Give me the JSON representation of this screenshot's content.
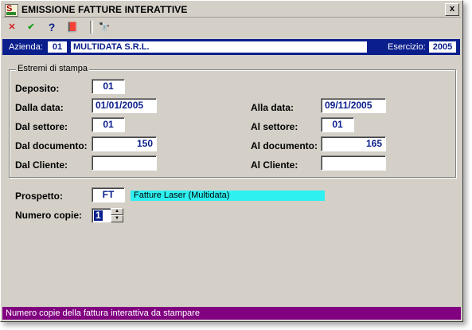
{
  "window": {
    "title": "EMISSIONE FATTURE INTERATTIVE",
    "close_label": "x"
  },
  "toolbar": {
    "cancel": "✕",
    "confirm": "✔",
    "help": "?",
    "book": "📕",
    "find": "🔭"
  },
  "company_bar": {
    "azienda_label": "Azienda:",
    "azienda_code": "01",
    "azienda_name": "MULTIDATA S.R.L.",
    "esercizio_label": "Esercizio:",
    "esercizio_value": "2005"
  },
  "group": {
    "title": "Estremi di stampa"
  },
  "fields": {
    "deposito_label": "Deposito:",
    "deposito_value": "01",
    "dalla_data_label": "Dalla data:",
    "dalla_data_value": "01/01/2005",
    "alla_data_label": "Alla data:",
    "alla_data_value": "09/11/2005",
    "dal_settore_label": "Dal settore:",
    "dal_settore_value": "01",
    "al_settore_label": "Al settore:",
    "al_settore_value": "01",
    "dal_documento_label": "Dal documento:",
    "dal_documento_value": "150",
    "al_documento_label": "Al documento:",
    "al_documento_value": "165",
    "dal_cliente_label": "Dal Cliente:",
    "dal_cliente_value": "",
    "al_cliente_label": "Al Cliente:",
    "al_cliente_value": ""
  },
  "prospetto": {
    "label": "Prospetto:",
    "code": "FT",
    "description": "Fatture Laser (Multidata)"
  },
  "copie": {
    "label": "Numero copie:",
    "value": "1"
  },
  "status": {
    "text": "Numero copie della fattura interattiva da stampare"
  },
  "colors": {
    "company_bar": "#0a1e8c",
    "status_bar": "#800080",
    "highlight": "#2ef0f0"
  }
}
